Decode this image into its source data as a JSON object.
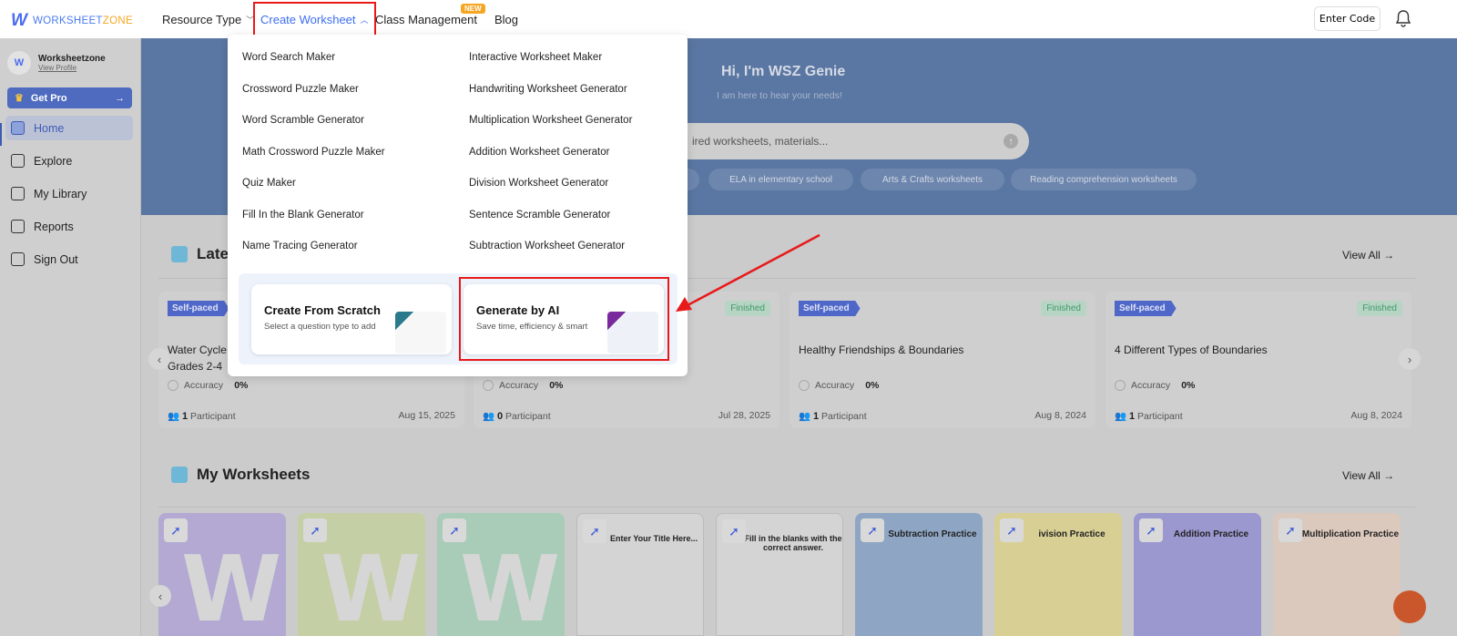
{
  "header": {
    "logo_mark": "W",
    "logo_text_a": "WORKSHEET",
    "logo_text_b": "ZONE",
    "nav": [
      {
        "label": "Resource Type",
        "chevron": "down"
      },
      {
        "label": "Create Worksheet",
        "chevron": "up",
        "active": true
      },
      {
        "label": "Class Management",
        "badge": "NEW"
      },
      {
        "label": "Blog"
      }
    ],
    "enter_code": "Enter Code"
  },
  "sidebar": {
    "profile_name": "Worksheetzone",
    "profile_link": "View Profile",
    "get_pro": "Get Pro",
    "items": [
      {
        "label": "Home",
        "active": true
      },
      {
        "label": "Explore"
      },
      {
        "label": "My Library"
      },
      {
        "label": "Reports"
      },
      {
        "label": "Sign Out"
      }
    ]
  },
  "banner": {
    "title": "Hi, I'm WSZ Genie",
    "subtitle": "I am here to hear your needs!",
    "search_placeholder": "ired worksheets, materials...",
    "chips": [
      "ELA in elementary school",
      "Arts & Crafts worksheets",
      "Reading comprehension worksheets"
    ]
  },
  "latest": {
    "title": "Latest",
    "view_all": "View All →",
    "cards": [
      {
        "mode": "Self-paced",
        "status": "",
        "title": "Water Cycle",
        "title2": "Grades 2-4",
        "accuracy_label": "Accuracy",
        "accuracy": "0%",
        "participants": "1",
        "participant_label": "Participant",
        "date": "Aug 15, 2025"
      },
      {
        "mode": "",
        "status": "Finished",
        "title": "",
        "title2": "",
        "accuracy_label": "Accuracy",
        "accuracy": "0%",
        "participants": "0",
        "participant_label": "Participant",
        "date": "Jul 28, 2025"
      },
      {
        "mode": "Self-paced",
        "status": "Finished",
        "title": "Healthy Friendships & Boundaries",
        "title2": "",
        "accuracy_label": "Accuracy",
        "accuracy": "0%",
        "participants": "1",
        "participant_label": "Participant",
        "date": "Aug 8, 2024"
      },
      {
        "mode": "Self-paced",
        "status": "Finished",
        "title": "4 Different Types of Boundaries",
        "title2": "",
        "accuracy_label": "Accuracy",
        "accuracy": "0%",
        "participants": "1",
        "participant_label": "Participant",
        "date": "Aug 8, 2024"
      }
    ]
  },
  "my_worksheets": {
    "title": "My Worksheets",
    "view_all": "View All →",
    "tiles": [
      {
        "kind": "blank",
        "color": "#b3a9d3"
      },
      {
        "kind": "blank",
        "color": "#c5cfa5"
      },
      {
        "kind": "blank",
        "color": "#a8ccb7"
      },
      {
        "kind": "paper",
        "title": "Enter Your Title Here..."
      },
      {
        "kind": "paper",
        "title": "Fill in the blanks with the correct answer."
      },
      {
        "kind": "color",
        "title": "Subtraction Practice",
        "color": "#8ea6c4"
      },
      {
        "kind": "color",
        "title": "ivision Practice",
        "color": "#d8cf95"
      },
      {
        "kind": "color",
        "title": "Addition Practice",
        "color": "#9b97cf"
      },
      {
        "kind": "color",
        "title": "Multiplication Practice",
        "color": "#dcc9bd"
      }
    ]
  },
  "dropdown": {
    "left": [
      "Word Search Maker",
      "Crossword Puzzle Maker",
      "Word Scramble Generator",
      "Math Crossword Puzzle Maker",
      "Quiz Maker",
      "Fill In the Blank Generator",
      "Name Tracing Generator"
    ],
    "right": [
      "Interactive Worksheet Maker",
      "Handwriting Worksheet Generator",
      "Multiplication Worksheet Generator",
      "Addition Worksheet Generator",
      "Division Worksheet Generator",
      "Sentence Scramble Generator",
      "Subtraction Worksheet Generator"
    ],
    "scratch": {
      "title": "Create From Scratch",
      "subtitle": "Select a question type to add"
    },
    "ai": {
      "title": "Generate by AI",
      "subtitle": "Save time, efficiency & smart"
    }
  },
  "colors": {
    "accent": "#3d6df2",
    "highlight": "#e8191a",
    "pro": "#f5a623"
  }
}
